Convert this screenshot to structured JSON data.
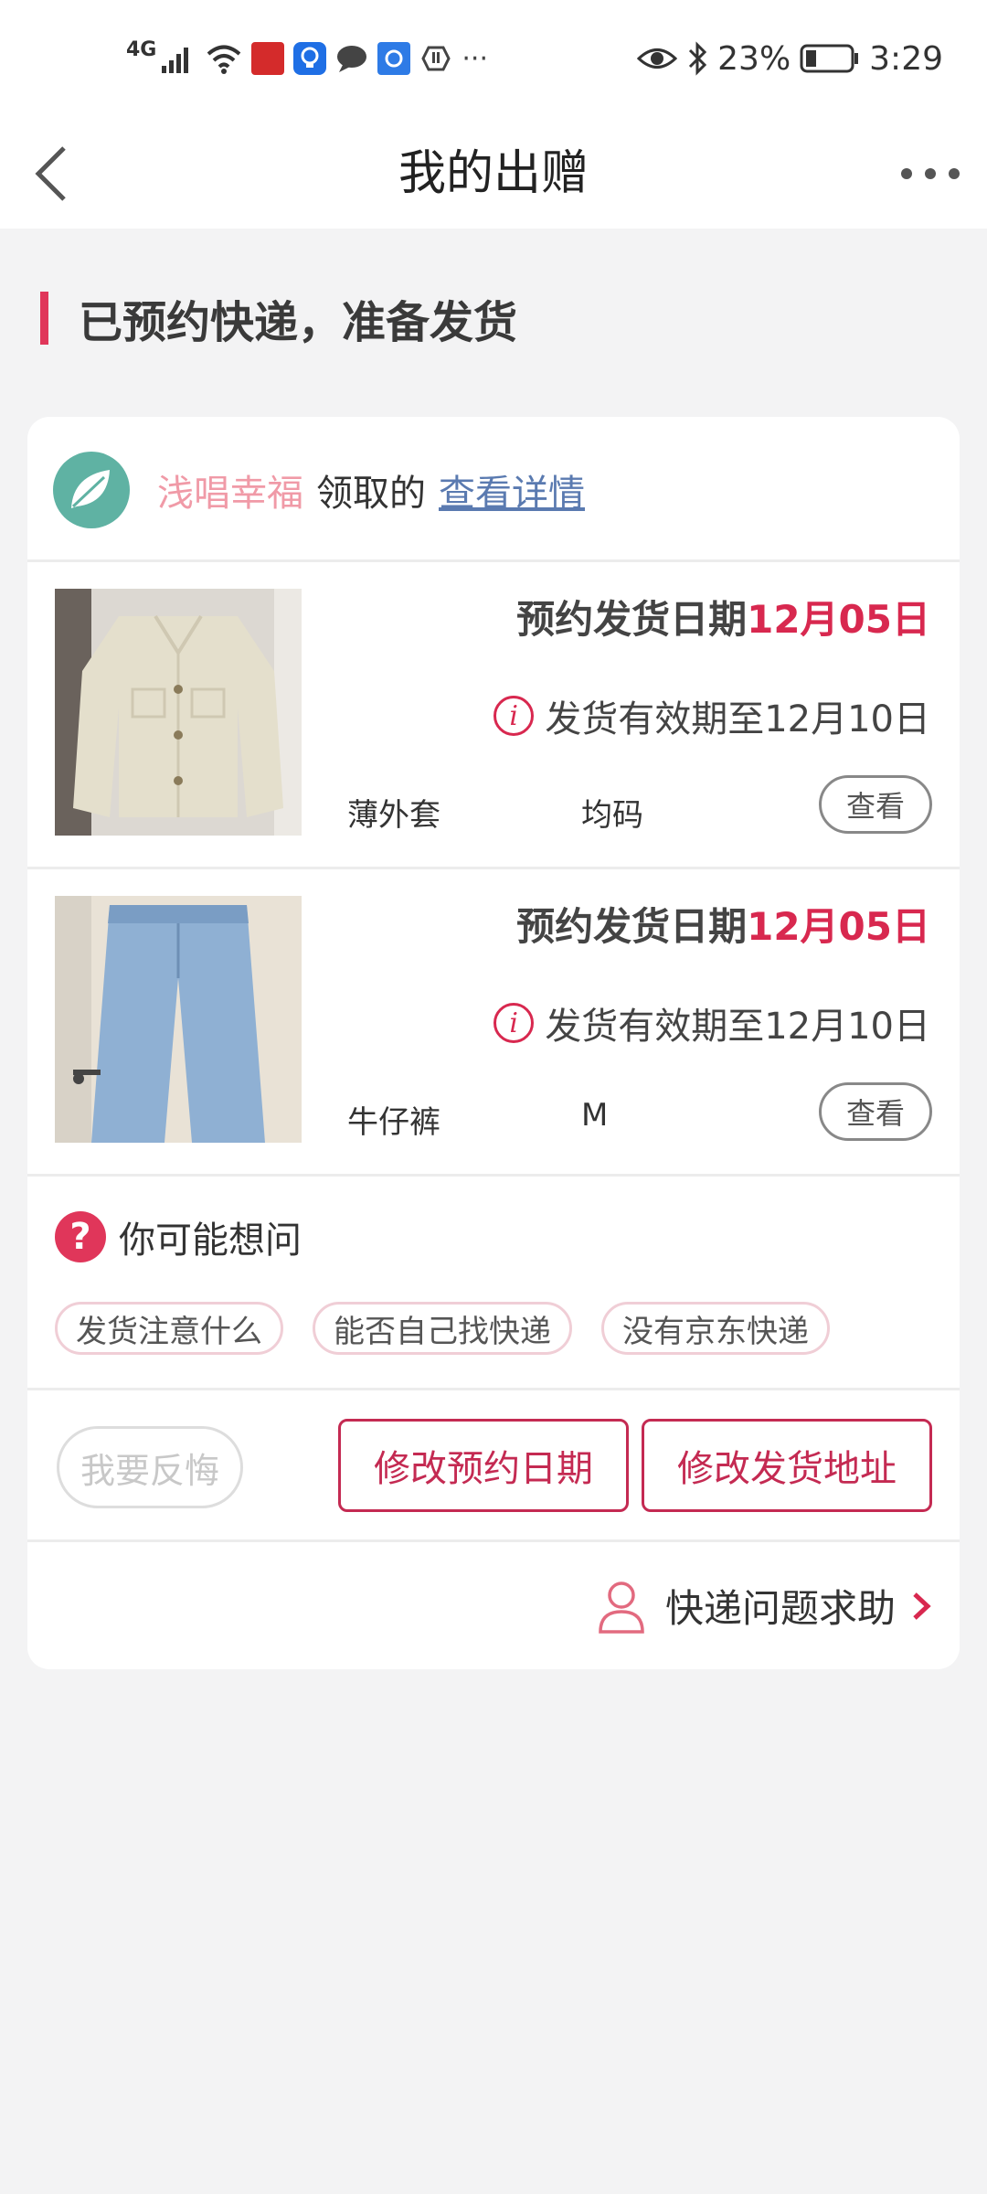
{
  "status_bar": {
    "network": "4G",
    "battery_percent": "23%",
    "time": "3:29",
    "icons": [
      "signal-icon",
      "wifi-icon",
      "app-icon-red",
      "bulb-icon",
      "chat-icon",
      "app-icon-blue",
      "hand-icon",
      "more-dots-icon"
    ],
    "right_icons": [
      "eye-icon",
      "bluetooth-icon",
      "battery-icon"
    ]
  },
  "nav": {
    "title": "我的出赠",
    "back_icon": "chevron-left-icon",
    "more_icon": "more-dots-icon"
  },
  "section": {
    "title": "已预约快递，准备发货",
    "accent_color": "#e0365a"
  },
  "receiver": {
    "name": "浅唱幸福",
    "action": "领取的",
    "link": "查看详情"
  },
  "items": [
    {
      "ship_label": "预约发货日期",
      "ship_date": "12月05日",
      "valid_until": "发货有效期至12月10日",
      "name": "薄外套",
      "size": "均码",
      "view_label": "查看",
      "thumb": "beige-jacket-photo"
    },
    {
      "ship_label": "预约发货日期",
      "ship_date": "12月05日",
      "valid_until": "发货有效期至12月10日",
      "name": "牛仔裤",
      "size": "M",
      "view_label": "查看",
      "thumb": "blue-jeans-photo"
    }
  ],
  "faq": {
    "label": "你可能想问",
    "chips": [
      "发货注意什么",
      "能否自己找快递",
      "没有京东快递"
    ]
  },
  "actions": {
    "regret": "我要反悔",
    "change_date": "修改预约日期",
    "change_address": "修改发货地址"
  },
  "help": {
    "label": "快递问题求助"
  }
}
